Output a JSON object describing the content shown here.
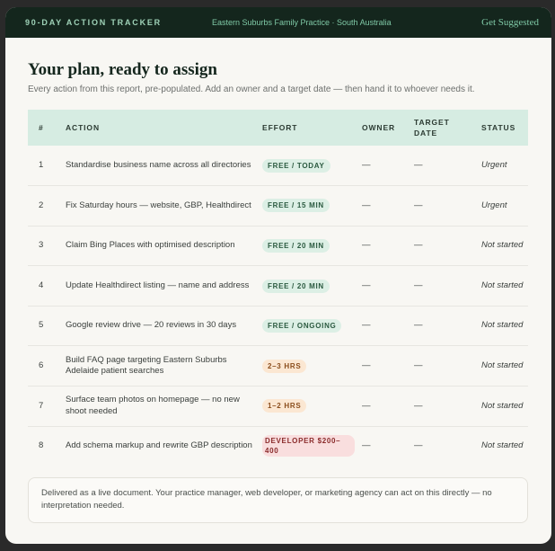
{
  "topbar": {
    "brand": "90-DAY ACTION TRACKER",
    "practice": "Eastern Suburbs Family Practice · South Australia",
    "cta": "Get Suggested"
  },
  "heading": "Your plan, ready to assign",
  "subheading": "Every action from this report, pre-populated. Add an owner and a target date — then hand it to whoever needs it.",
  "columns": [
    "#",
    "ACTION",
    "EFFORT",
    "OWNER",
    "TARGET DATE",
    "STATUS"
  ],
  "rows": [
    {
      "num": "1",
      "action": "Standardise business name across all directories",
      "effort": "FREE / TODAY",
      "effort_tone": "green",
      "owner": "—",
      "date": "—",
      "status": "Urgent"
    },
    {
      "num": "2",
      "action": "Fix Saturday hours — website, GBP, Healthdirect",
      "effort": "FREE / 15 MIN",
      "effort_tone": "green",
      "owner": "—",
      "date": "—",
      "status": "Urgent"
    },
    {
      "num": "3",
      "action": "Claim Bing Places with optimised description",
      "effort": "FREE / 20 MIN",
      "effort_tone": "green",
      "owner": "—",
      "date": "—",
      "status": "Not started"
    },
    {
      "num": "4",
      "action": "Update Healthdirect listing — name and address",
      "effort": "FREE / 20 MIN",
      "effort_tone": "green",
      "owner": "—",
      "date": "—",
      "status": "Not started"
    },
    {
      "num": "5",
      "action": "Google review drive — 20 reviews in 30 days",
      "effort": "FREE / ONGOING",
      "effort_tone": "green",
      "owner": "—",
      "date": "—",
      "status": "Not started"
    },
    {
      "num": "6",
      "action": "Build FAQ page targeting Eastern Suburbs Adelaide patient searches",
      "effort": "2–3 HRS",
      "effort_tone": "amber",
      "owner": "—",
      "date": "—",
      "status": "Not started"
    },
    {
      "num": "7",
      "action": "Surface team photos on homepage — no new shoot needed",
      "effort": "1–2 HRS",
      "effort_tone": "amber",
      "owner": "—",
      "date": "—",
      "status": "Not started"
    },
    {
      "num": "8",
      "action": "Add schema markup and rewrite GBP description",
      "effort": "DEVELOPER $200–400",
      "effort_tone": "red",
      "owner": "—",
      "date": "—",
      "status": "Not started"
    }
  ],
  "note": "Delivered as a live document. Your practice manager, web developer, or marketing agency can act on this directly — no interpretation needed.",
  "colors": {
    "topbar_bg": "#14261d",
    "header_row_bg": "#d6ece2",
    "pill_green": "#dcefe5",
    "pill_amber": "#fbe7d2",
    "pill_red": "#f9dede"
  }
}
